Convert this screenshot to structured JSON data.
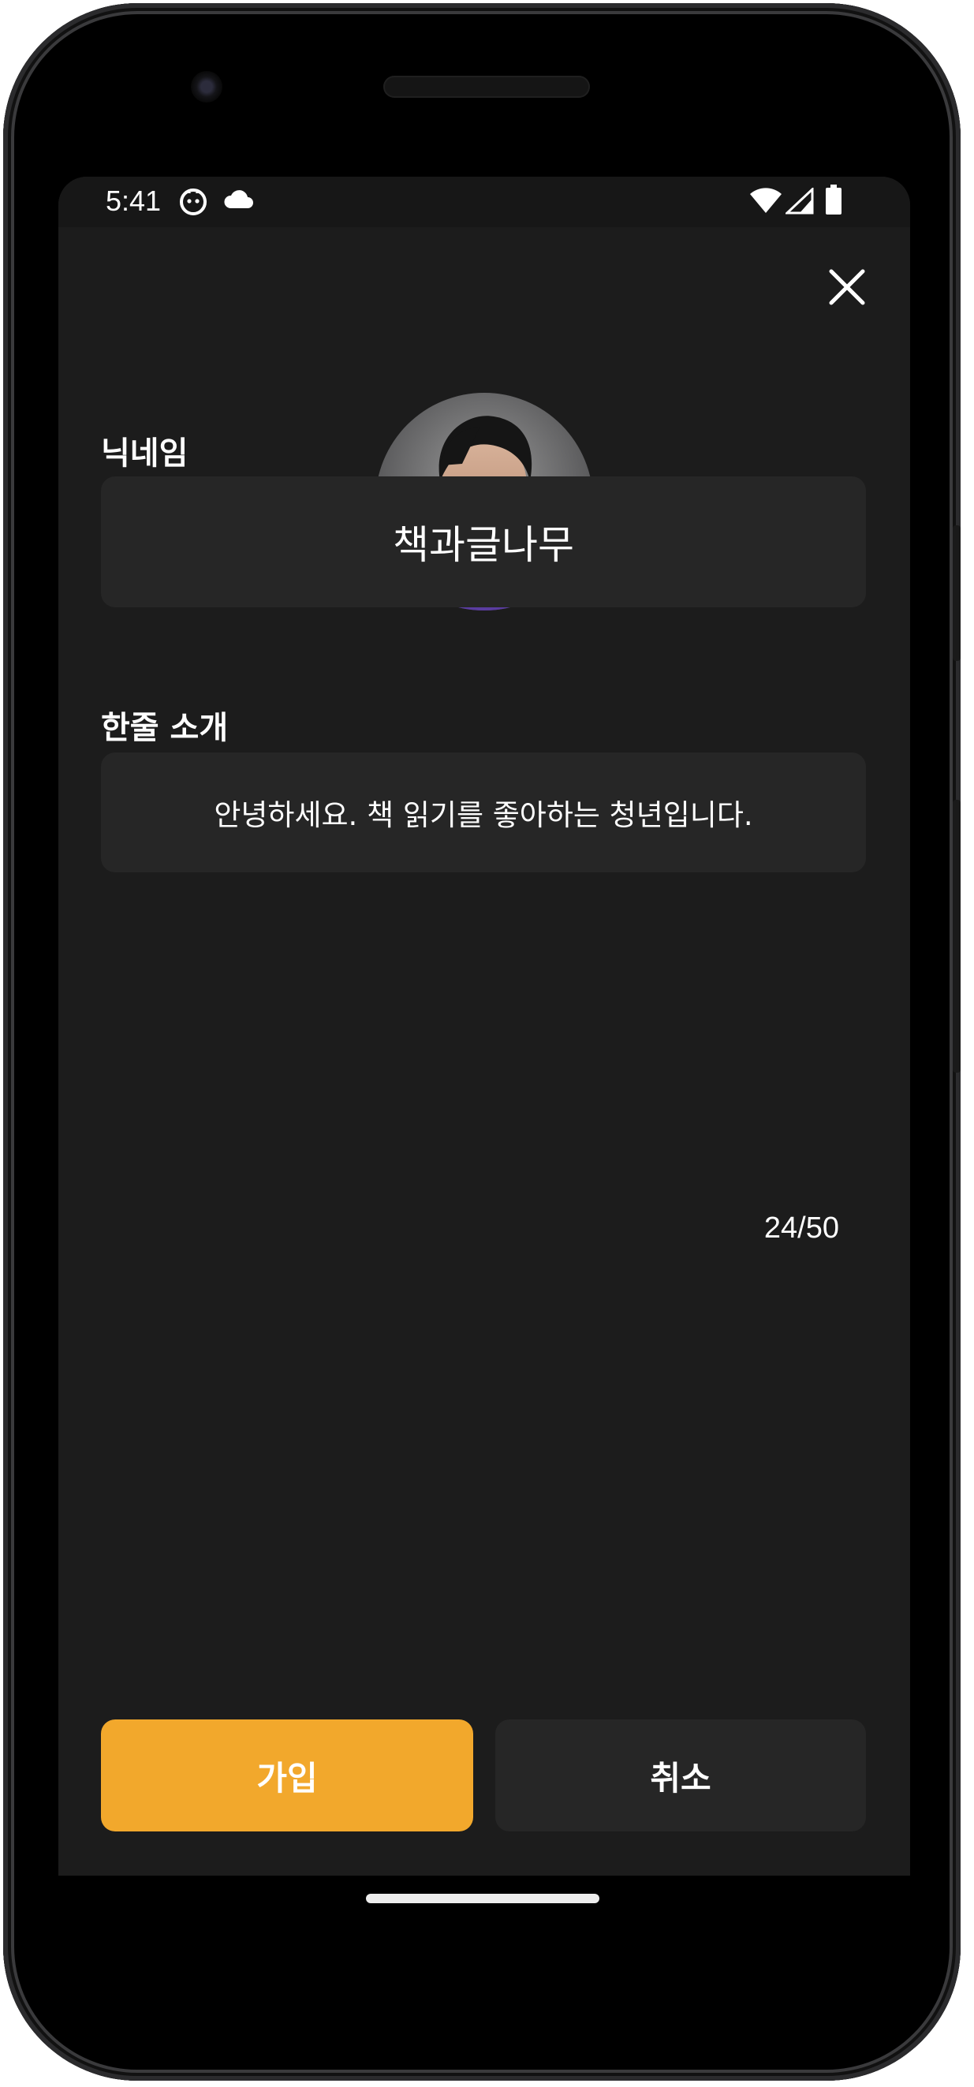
{
  "status_bar": {
    "time": "5:41",
    "left_icons": [
      "face-notification-icon",
      "cloud-icon"
    ],
    "right_icons": [
      "wifi-icon",
      "signal-icon",
      "battery-icon"
    ]
  },
  "header": {
    "close_icon": "close-icon"
  },
  "profile": {
    "avatar_alt": "profile photo"
  },
  "nickname": {
    "label": "닉네임",
    "value": "책과글나무"
  },
  "intro": {
    "label": "한줄 소개",
    "value": "안녕하세요. 책 읽기를 좋아하는 청년입니다.",
    "counter": "24/50"
  },
  "actions": {
    "join_label": "가입",
    "cancel_label": "취소"
  },
  "colors": {
    "background": "#1c1c1c",
    "field": "#262626",
    "accent": "#f2a82c",
    "text": "#ffffff"
  }
}
